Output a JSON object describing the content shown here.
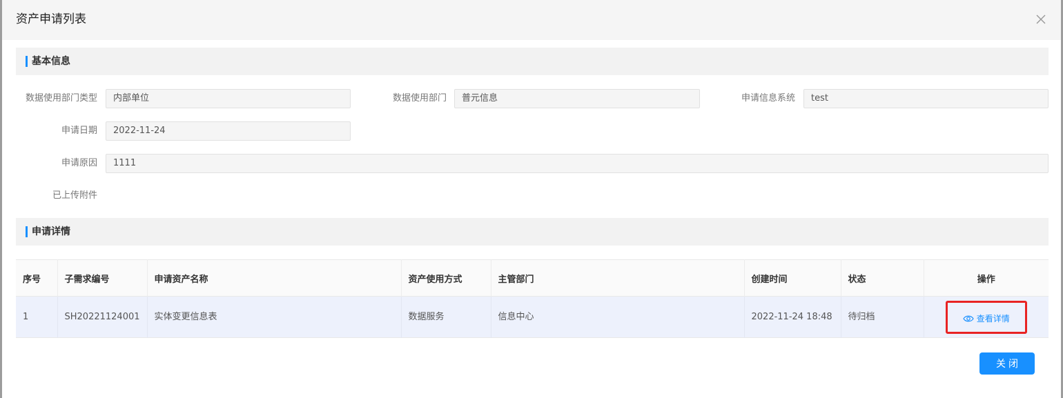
{
  "dialog": {
    "title": "资产申请列表",
    "close_icon": "close-icon"
  },
  "basic_info": {
    "section_title": "基本信息",
    "fields": {
      "dept_type": {
        "label": "数据使用部门类型",
        "value": "内部单位"
      },
      "dept": {
        "label": "数据使用部门",
        "value": "普元信息"
      },
      "system": {
        "label": "申请信息系统",
        "value": "test"
      },
      "date": {
        "label": "申请日期",
        "value": "2022-11-24"
      },
      "reason": {
        "label": "申请原因",
        "value": "1111"
      },
      "attachments": {
        "label": "已上传附件"
      }
    }
  },
  "details": {
    "section_title": "申请详情",
    "columns": [
      "序号",
      "子需求编号",
      "申请资产名称",
      "资产使用方式",
      "主管部门",
      "创建时间",
      "状态",
      "操作"
    ],
    "rows": [
      {
        "index": "1",
        "sub_id": "SH20221124001",
        "asset_name": "实体变更信息表",
        "usage": "数据服务",
        "dept": "信息中心",
        "created": "2022-11-24 18:48",
        "status": "待归档",
        "action": "查看详情",
        "action_icon": "eye-icon"
      }
    ]
  },
  "footer": {
    "close_label": "关闭"
  },
  "colors": {
    "primary": "#1890ff",
    "highlight_border": "#e82323",
    "row_highlight": "#edf1fc"
  }
}
